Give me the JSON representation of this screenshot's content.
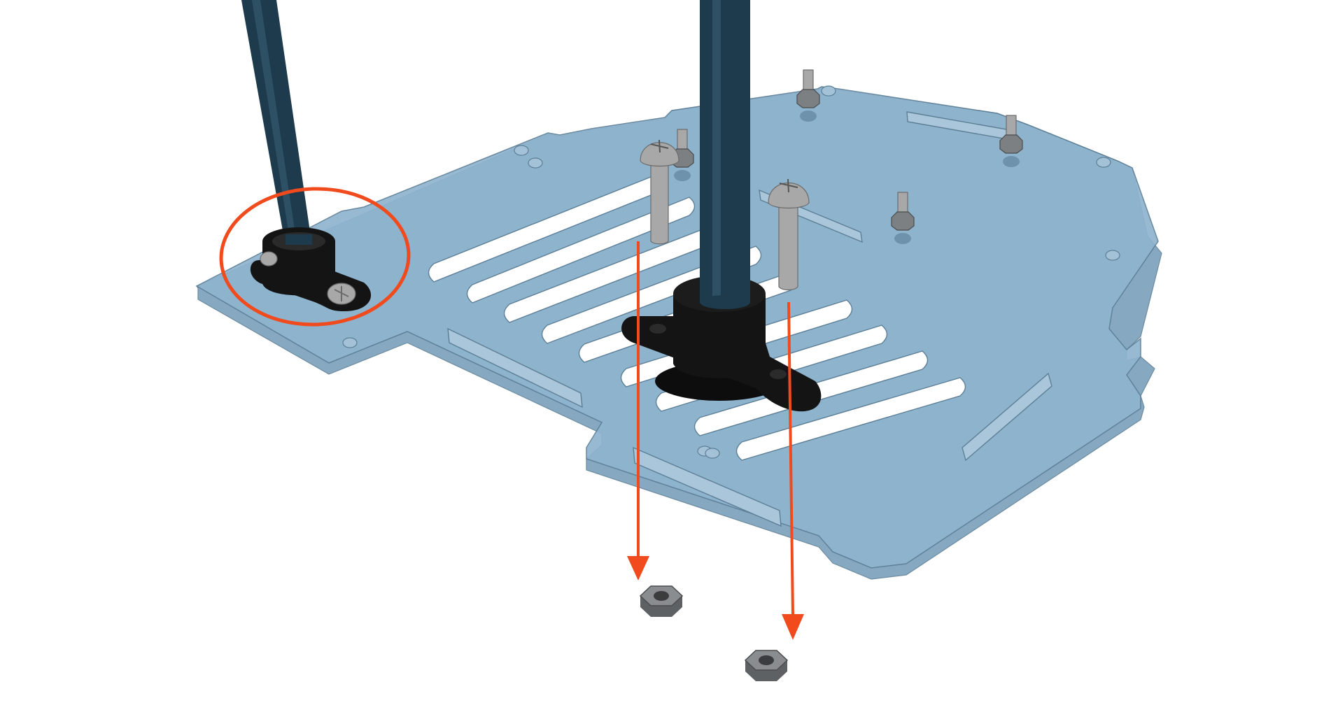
{
  "figure": {
    "kind": "assembly-illustration",
    "caption": "",
    "parts": {
      "base_plate": "base-plate",
      "rods": 2,
      "mount_clamps": 2,
      "bolts": 2,
      "nuts_shown_below": 2,
      "standoffs": 4
    }
  },
  "colors": {
    "background": "#ffffff",
    "plate_fill": "#8fb4cf",
    "plate_edge": "#5d7f96",
    "plate_side": "#7aa0bb",
    "slot_fill": "#ffffff",
    "rod": "#1d3b4c",
    "rod_highlight": "#3a6378",
    "clamp": "#141414",
    "metal": "#a8a8a8",
    "metal_dark": "#6b6b6b",
    "annotation": "#f04a1d"
  },
  "annotations": {
    "highlight_circle": "reference-assembly",
    "arrows": [
      "bolt-1-to-nut-1",
      "bolt-2-to-nut-2"
    ]
  }
}
